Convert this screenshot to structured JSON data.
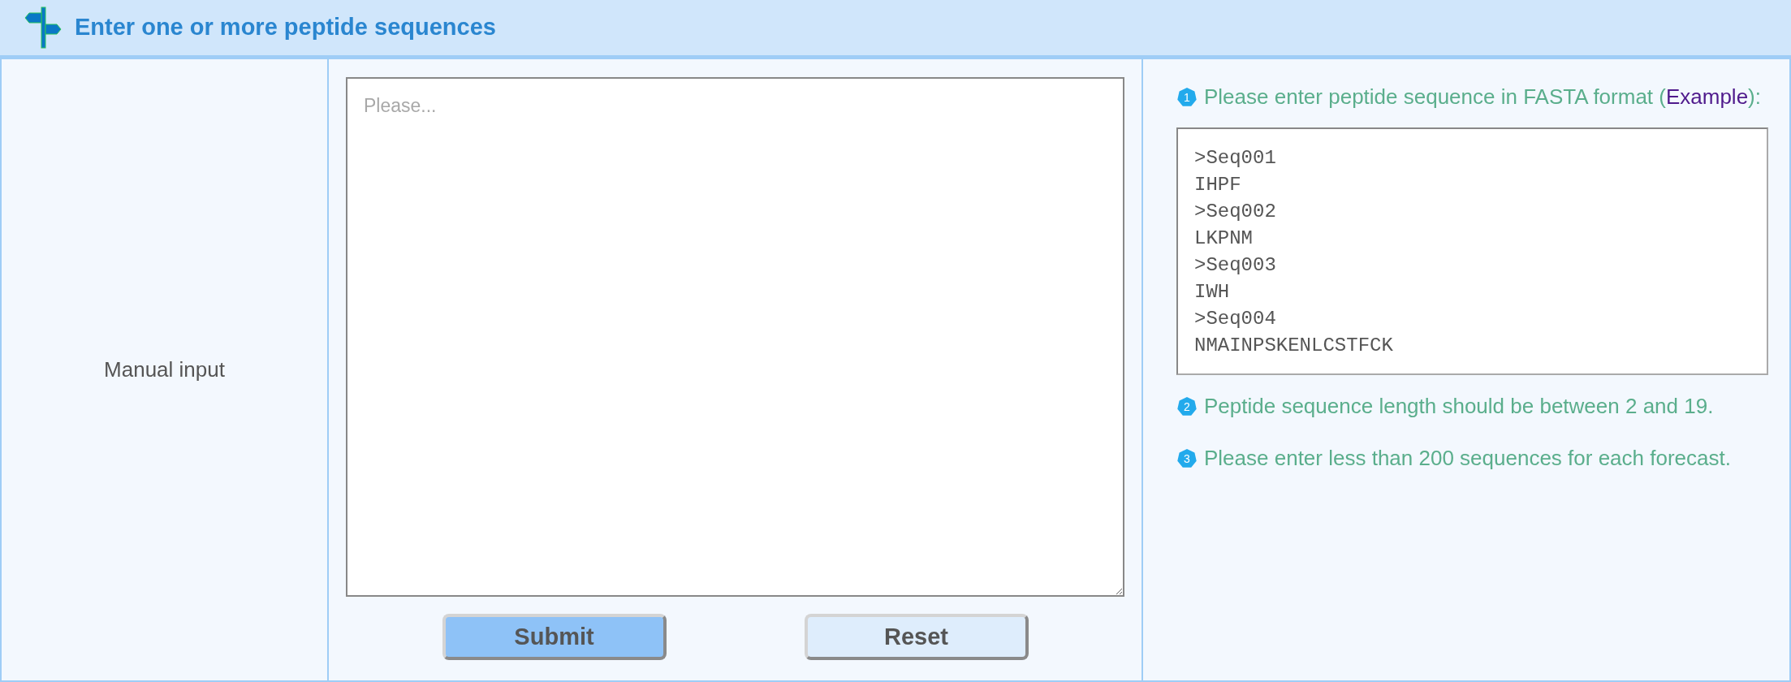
{
  "header": {
    "title": "Enter one or more peptide sequences"
  },
  "row_label": "Manual input",
  "input": {
    "placeholder": "Please..."
  },
  "buttons": [
    {
      "label": "Submit",
      "kind": "primary"
    },
    {
      "label": "Reset",
      "kind": "secondary"
    }
  ],
  "instructions": [
    {
      "number": "1",
      "text": "Please enter peptide sequence in FASTA format (",
      "link": "Example",
      "text_after": "):"
    },
    {
      "number": "2",
      "text": "Peptide sequence length should be between 2 and 19."
    },
    {
      "number": "3",
      "text": "Please enter less than 200 sequences for each forecast."
    }
  ],
  "example_lines": [
    ">Seq001",
    "IHPF",
    ">Seq002",
    "LKPNM",
    ">Seq003",
    "IWH",
    ">Seq004",
    "NMAINPSKENLCSTFCK"
  ]
}
